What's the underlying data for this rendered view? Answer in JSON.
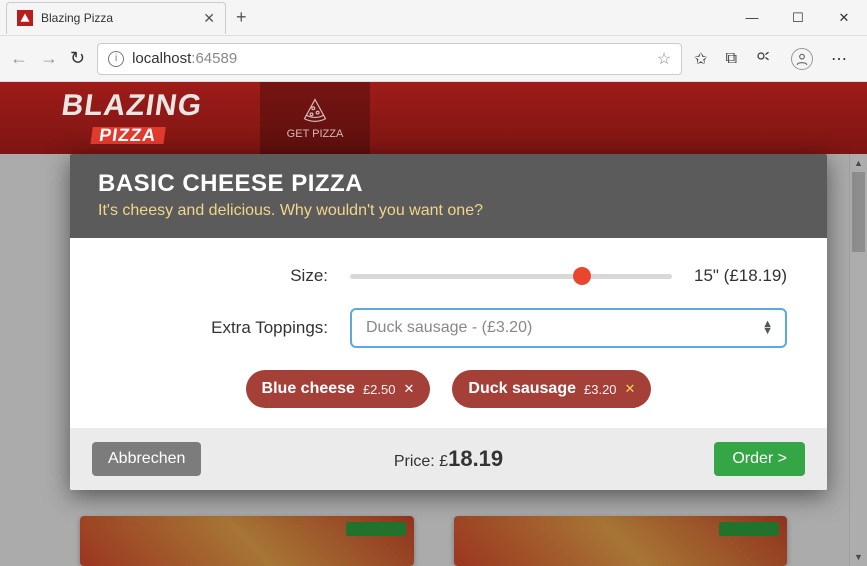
{
  "browser": {
    "tab_title": "Blazing Pizza",
    "url_host": "localhost",
    "url_port": ":64589"
  },
  "header": {
    "logo_line1": "BLAZING",
    "logo_line2": "PIZZA",
    "nav_label": "GET PIZZA"
  },
  "modal": {
    "title": "BASIC CHEESE PIZZA",
    "subtitle": "It's cheesy and delicious. Why wouldn't you want one?",
    "size_label": "Size:",
    "size_value": "15\" (£18.19)",
    "toppings_label": "Extra Toppings:",
    "select_placeholder": "Duck sausage - (£3.20)",
    "chips": [
      {
        "name": "Blue cheese",
        "price": "£2.50"
      },
      {
        "name": "Duck sausage",
        "price": "£3.20"
      }
    ],
    "cancel_label": "Abbrechen",
    "price_prefix": "Price: £",
    "price_value": "18.19",
    "order_label": "Order >"
  }
}
